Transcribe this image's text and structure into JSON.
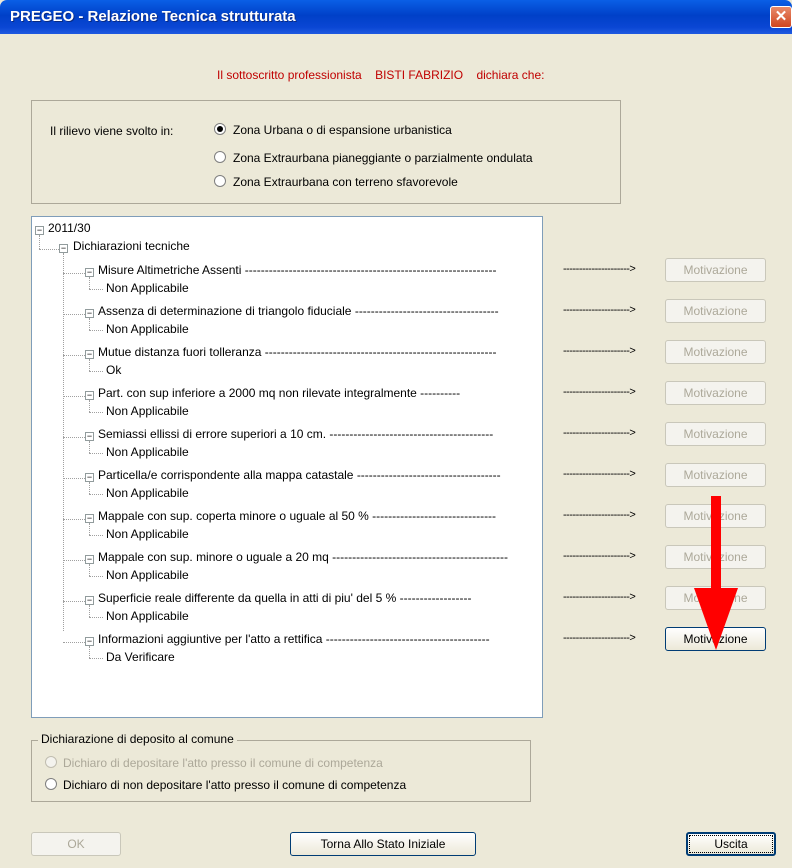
{
  "window": {
    "title": "PREGEO - Relazione Tecnica strutturata",
    "close_glyph": "✕"
  },
  "declaration": {
    "prefix": "Il sottoscritto professionista",
    "name": "BISTI FABRIZIO",
    "suffix": "dichiara che:"
  },
  "rilievo": {
    "label": "Il rilievo viene svolto in:",
    "options": [
      {
        "label": "Zona Urbana o di espansione urbanistica",
        "checked": true
      },
      {
        "label": "Zona Extraurbana pianeggiante o parzialmente ondulata",
        "checked": false
      },
      {
        "label": "Zona Extraurbana con terreno sfavorevole",
        "checked": false
      }
    ]
  },
  "tree": {
    "root": "2011/30",
    "group": "Dichiarazioni tecniche",
    "arrow": "--------------------->",
    "items": [
      {
        "label": "Misure Altimetriche Assenti ---------------------------------------------------------------",
        "value": "Non Applicabile",
        "button": "Motivazione",
        "enabled": false
      },
      {
        "label": "Assenza di determinazione di triangolo fiduciale ------------------------------------",
        "value": "Non Applicabile",
        "button": "Motivazione",
        "enabled": false
      },
      {
        "label": "Mutue distanza fuori tolleranza ----------------------------------------------------------",
        "value": "Ok",
        "button": "Motivazione",
        "enabled": false
      },
      {
        "label": "Part. con sup inferiore a 2000 mq non rilevate integralmente ----------",
        "value": "Non Applicabile",
        "button": "Motivazione",
        "enabled": false
      },
      {
        "label": "Semiassi ellissi di errore superiori a 10 cm. -----------------------------------------",
        "value": "Non Applicabile",
        "button": "Motivazione",
        "enabled": false
      },
      {
        "label": "Particella/e corrispondente alla mappa catastale ------------------------------------",
        "value": "Non Applicabile",
        "button": "Motivazione",
        "enabled": false
      },
      {
        "label": "Mappale con sup. coperta minore o uguale al 50 % -------------------------------",
        "value": "Non Applicabile",
        "button": "Motivazione",
        "enabled": false
      },
      {
        "label": "Mappale con sup. minore o uguale a 20 mq --------------------------------------------",
        "value": "Non Applicabile",
        "button": "Motivazione",
        "enabled": false
      },
      {
        "label": "Superficie reale differente da quella in atti di piu' del 5 % ------------------",
        "value": "Non Applicabile",
        "button": "Motivazione",
        "enabled": false
      },
      {
        "label": "Informazioni aggiuntive per l'atto a rettifica -----------------------------------------",
        "value": "Da Verificare",
        "button": "Motivazione",
        "enabled": true
      }
    ]
  },
  "deposito": {
    "legend": "Dichiarazione di deposito al comune",
    "options": [
      {
        "label": "Dichiaro di depositare l'atto presso il comune di competenza",
        "disabled": true
      },
      {
        "label": "Dichiaro di non depositare l'atto presso il comune di competenza",
        "disabled": false
      }
    ]
  },
  "footer": {
    "ok": "OK",
    "reset": "Torna Allo Stato Iniziale",
    "exit": "Uscita"
  },
  "annotation": {
    "color": "#ff0000",
    "target": "Motivazione"
  }
}
